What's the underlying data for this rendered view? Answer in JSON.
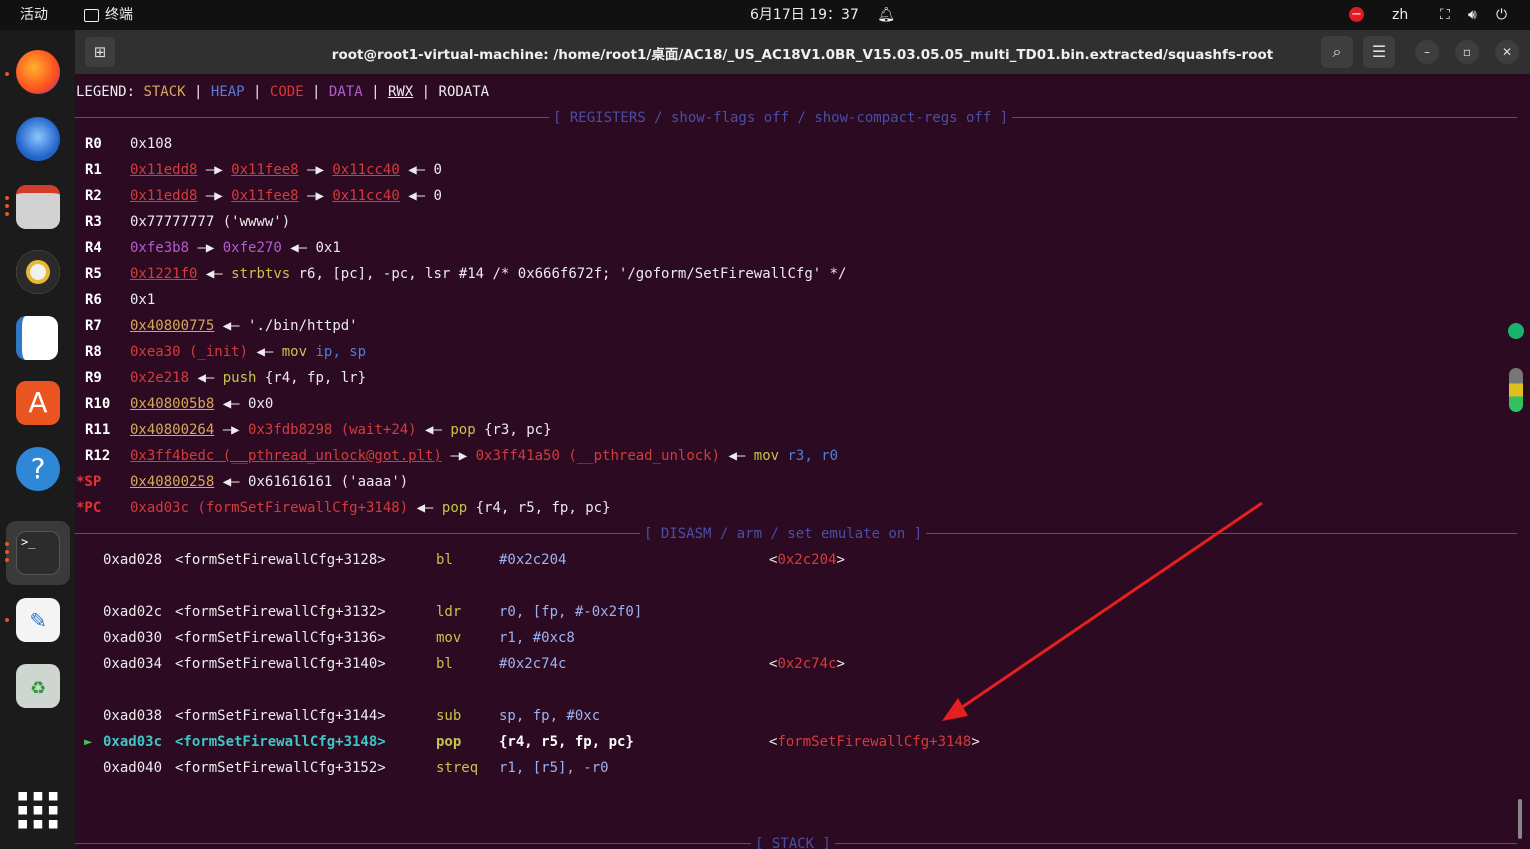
{
  "topbar": {
    "activities": "活动",
    "app_name": "终端",
    "datetime": "6月17日 19：37",
    "input_method": "zh"
  },
  "window": {
    "title": "root@root1-virtual-machine: /home/root1/桌面/AC18/_US_AC18V1.0BR_V15.03.05.05_multi_TD01.bin.extracted/squashfs-root"
  },
  "legend": {
    "prefix": "LEGEND: ",
    "stack": "STACK",
    "heap": "HEAP",
    "code": "CODE",
    "data": "DATA",
    "rwx": "RWX",
    "rodata": "RODATA",
    "sep": " | "
  },
  "registers_header": "[ REGISTERS / show-flags off / show-compact-regs off ]",
  "registers": {
    "r0": {
      "name": "R0",
      "v": "0x108"
    },
    "r1": {
      "name": "R1",
      "a": "0x11edd8",
      "b": "0x11fee8",
      "c": "0x11cc40",
      "d": "0"
    },
    "r2": {
      "name": "R2",
      "a": "0x11edd8",
      "b": "0x11fee8",
      "c": "0x11cc40",
      "d": "0"
    },
    "r3": {
      "name": "R3",
      "v": "0x77777777 ('wwww')"
    },
    "r4": {
      "name": "R4",
      "a": "0xfe3b8",
      "b": "0xfe270",
      "c": "0x1"
    },
    "r5": {
      "name": "R5",
      "a": "0x1221f0",
      "ins": "strbtvs",
      "rest": " r6, [pc], -pc, lsr #14 /* 0x666f672f; '/goform/SetFirewallCfg' */"
    },
    "r6": {
      "name": "R6",
      "v": "0x1"
    },
    "r7": {
      "name": "R7",
      "a": "0x40800775",
      "b": "'./bin/httpd'"
    },
    "r8": {
      "name": "R8",
      "a": "0xea30 (_init)",
      "ins": "mov",
      "rest": " ip, sp"
    },
    "r9": {
      "name": "R9",
      "a": "0x2e218",
      "ins": "push",
      "rest": " {r4, fp, lr}"
    },
    "r10": {
      "name": "R10",
      "a": "0x408005b8",
      "b": "0x0"
    },
    "r11": {
      "name": "R11",
      "a": "0x40800264",
      "b": "0x3fdb8298 (wait+24)",
      "ins": "pop",
      "rest": " {r3, pc}"
    },
    "r12": {
      "name": "R12",
      "a": "0x3ff4bedc (__pthread_unlock@got.plt)",
      "b": "0x3ff41a50 (__pthread_unlock)",
      "ins": "mov",
      "rest": " r3, r0"
    },
    "sp": {
      "name": "*SP",
      "a": "0x40800258",
      "b": "0x61616161 ('aaaa')"
    },
    "pc": {
      "name": "*PC",
      "a": "0xad03c (formSetFirewallCfg+3148)",
      "ins": "pop",
      "rest": " {r4, r5, fp, pc}"
    }
  },
  "arrow_r": "—▶",
  "arrow_l": "◀—",
  "disasm_header": "[ DISASM / arm / set emulate on ]",
  "disasm": [
    {
      "addr": "0xad028",
      "sym": "<formSetFirewallCfg+3128>",
      "op": "bl",
      "args": "#0x2c204",
      "target": "<0x2c204>"
    },
    {
      "addr": "0xad02c",
      "sym": "<formSetFirewallCfg+3132>",
      "op": "ldr",
      "args": "r0, [fp, #-0x2f0]",
      "target": ""
    },
    {
      "addr": "0xad030",
      "sym": "<formSetFirewallCfg+3136>",
      "op": "mov",
      "args": "r1, #0xc8",
      "target": ""
    },
    {
      "addr": "0xad034",
      "sym": "<formSetFirewallCfg+3140>",
      "op": "bl",
      "args": "#0x2c74c",
      "target": "<0x2c74c>"
    },
    {
      "addr": "0xad038",
      "sym": "<formSetFirewallCfg+3144>",
      "op": "sub",
      "args": "sp, fp, #0xc",
      "target": ""
    },
    {
      "addr": "0xad03c",
      "sym": "<formSetFirewallCfg+3148>",
      "op": "pop",
      "args": "{r4, r5, fp, pc}",
      "target": "<formSetFirewallCfg+3148>"
    },
    {
      "addr": "0xad040",
      "sym": "<formSetFirewallCfg+3152>",
      "op": "streq",
      "args": "r1, [r5], -r0",
      "target": ""
    }
  ],
  "current_marker": "►",
  "stack_header": "[ STACK ]",
  "colors": {
    "terminal_bg": "#2b0a22",
    "separator": "#4a4fa6",
    "annotation_arrow": "#e62020"
  }
}
